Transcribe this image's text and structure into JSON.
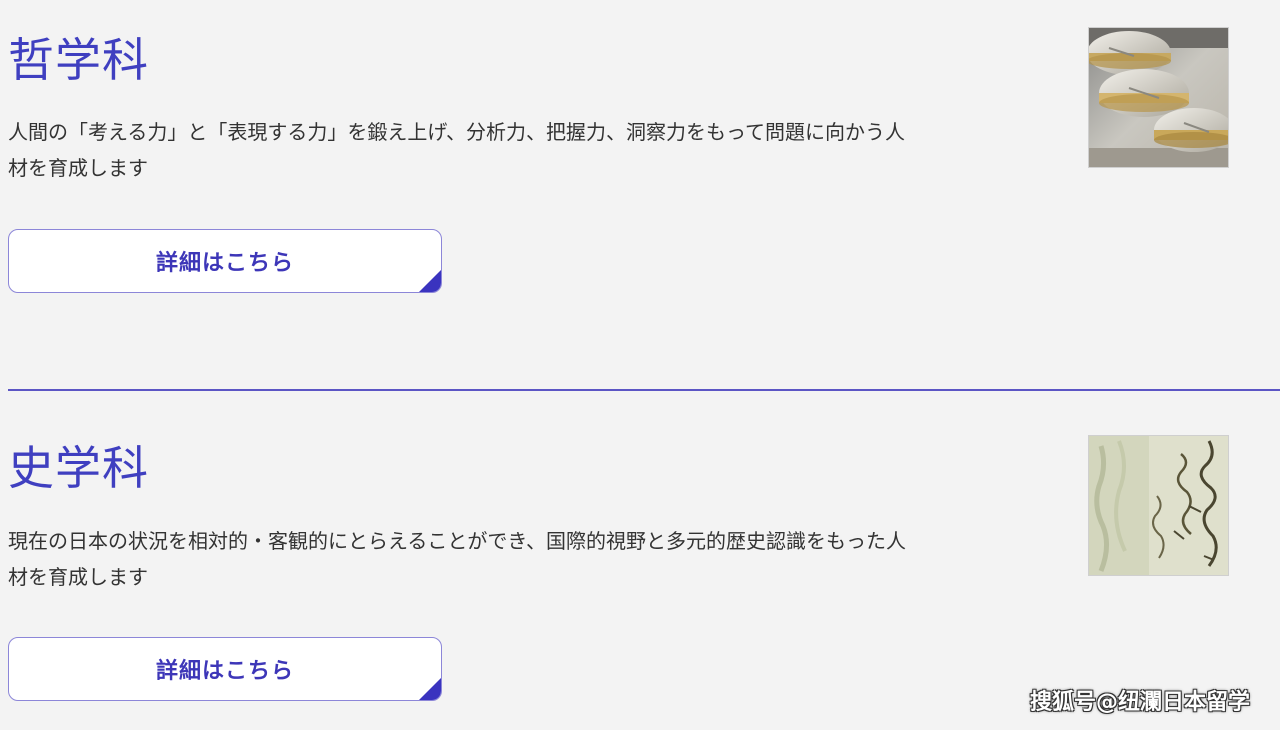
{
  "departments": [
    {
      "title": "哲学科",
      "description": "人間の「考える力」と「表現する力」を鍛え上げ、分析力、把握力、洞察力をもって問題に向かう人材を育成します",
      "button_label": "詳細はこちら",
      "image_alt": "coins-photo"
    },
    {
      "title": "史学科",
      "description": "現在の日本の状況を相対的・客観的にとらえることができ、国際的視野と多元的歴史認識をもった人材を育成します",
      "button_label": "詳細はこちら",
      "image_alt": "calligraphy-photo"
    }
  ],
  "watermark": "搜狐号@纽瀾日本留学",
  "colors": {
    "accent": "#3f3fc0",
    "button_border": "#8c86d8",
    "divider": "#5b55c4",
    "background": "#f3f3f3"
  }
}
